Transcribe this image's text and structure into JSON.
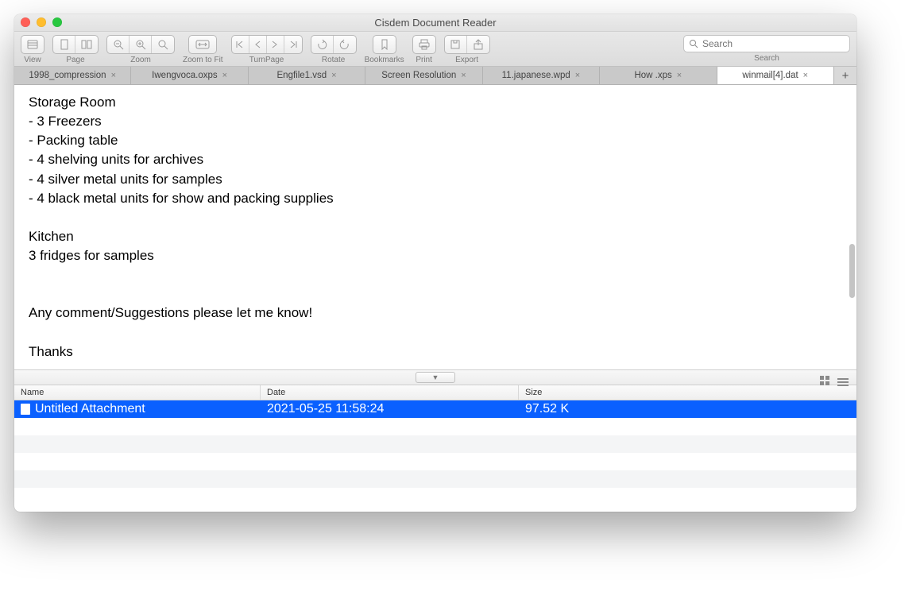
{
  "window": {
    "title": "Cisdem Document Reader"
  },
  "toolbar": {
    "groups": [
      {
        "id": "view",
        "label": "View"
      },
      {
        "id": "page",
        "label": "Page"
      },
      {
        "id": "zoom",
        "label": "Zoom"
      },
      {
        "id": "zoomfit",
        "label": "Zoom to Fit"
      },
      {
        "id": "turnpage",
        "label": "TurnPage"
      },
      {
        "id": "rotate",
        "label": "Rotate"
      },
      {
        "id": "bookmarks",
        "label": "Bookmarks"
      },
      {
        "id": "print",
        "label": "Print"
      },
      {
        "id": "export",
        "label": "Export"
      }
    ],
    "search_label": "Search",
    "search_placeholder": "Search"
  },
  "tabs": [
    {
      "label": "1998_compression"
    },
    {
      "label": "Iwengvoca.oxps"
    },
    {
      "label": "Engfile1.vsd"
    },
    {
      "label": "Screen Resolution"
    },
    {
      "label": "11.japanese.wpd"
    },
    {
      "label": "How .xps"
    },
    {
      "label": "winmail[4].dat",
      "active": true
    }
  ],
  "document_text": "Storage Room\n- 3 Freezers\n- Packing table\n- 4 shelving units for archives\n- 4 silver metal units for samples\n- 4 black metal units for show and packing supplies\n\nKitchen\n3 fridges for samples\n\n\nAny comment/Suggestions please let me know!\n\nThanks",
  "attachments": {
    "columns": {
      "name": "Name",
      "date": "Date",
      "size": "Size"
    },
    "rows": [
      {
        "name": "Untitled Attachment",
        "date": "2021-05-25 11:58:24",
        "size": "97.52 K",
        "selected": true
      }
    ]
  }
}
